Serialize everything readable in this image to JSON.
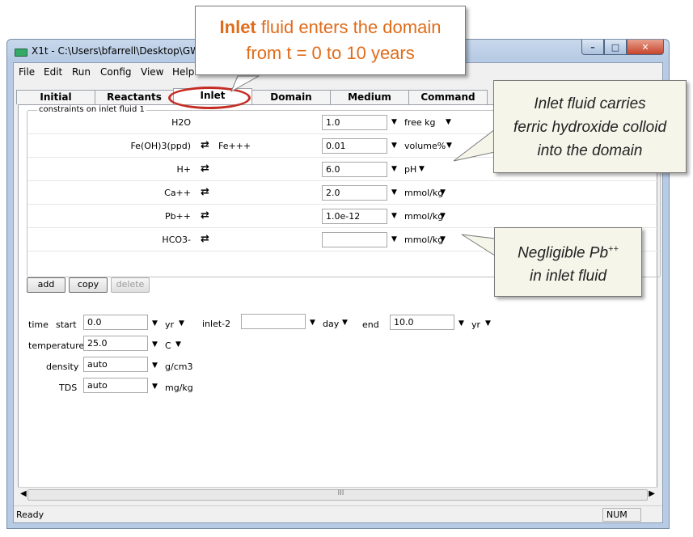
{
  "window": {
    "title": "X1t - C:\\Users\\bfarrell\\Desktop\\GWB10"
  },
  "title_controls": {
    "min": "–",
    "max": "□",
    "close": "✕"
  },
  "menu": [
    {
      "label": "File"
    },
    {
      "label": "Edit"
    },
    {
      "label": "Run"
    },
    {
      "label": "Config"
    },
    {
      "label": "View"
    },
    {
      "label": "Help"
    }
  ],
  "tabs": [
    {
      "label": "Initial"
    },
    {
      "label": "Reactants"
    },
    {
      "label": "Inlet"
    },
    {
      "label": "Domain"
    },
    {
      "label": "Medium"
    },
    {
      "label": "Command"
    }
  ],
  "constraints": {
    "legend": "constraints on inlet fluid 1",
    "swap_icon": "⇄",
    "rows": [
      {
        "species": "H2O",
        "swap": "",
        "basis": "",
        "value": "1.0",
        "unit": "free kg"
      },
      {
        "species": "Fe(OH)3(ppd)",
        "swap": "⇄",
        "basis": "Fe+++",
        "value": "0.01",
        "unit": "volume%"
      },
      {
        "species": "H+",
        "swap": "⇄",
        "basis": "",
        "value": "6.0",
        "unit": "pH"
      },
      {
        "species": "Ca++",
        "swap": "⇄",
        "basis": "",
        "value": "2.0",
        "unit": "mmol/kg"
      },
      {
        "species": "Pb++",
        "swap": "⇄",
        "basis": "",
        "value": "1.0e-12",
        "unit": "mmol/kg"
      },
      {
        "species": "HCO3-",
        "swap": "⇄",
        "basis": "",
        "value": "",
        "unit": "mmol/kg"
      }
    ]
  },
  "buttons": {
    "add": "add",
    "copy": "copy",
    "delete": "delete"
  },
  "time": {
    "label": "time",
    "start_label": "start",
    "start_value": "0.0",
    "start_unit": "yr",
    "inlet_label": "inlet-2",
    "inlet_value": "",
    "inlet_unit": "day",
    "end_label": "end",
    "end_value": "10.0",
    "end_unit": "yr"
  },
  "temperature": {
    "label": "temperature",
    "value": "25.0",
    "unit": "C"
  },
  "density": {
    "label": "density",
    "value": "auto",
    "unit": "g/cm3"
  },
  "tds": {
    "label": "TDS",
    "value": "auto",
    "unit": "mg/kg"
  },
  "scroll_thumb": "III",
  "status": {
    "text": "Ready",
    "num": "NUM"
  },
  "callouts": {
    "top_bold": "Inlet",
    "top_line1": " fluid enters the domain",
    "top_line2": "from t = 0 to 10 years",
    "side1_l1": "Inlet fluid carries",
    "side1_l2": "ferric hydroxide colloid",
    "side1_l3": "into the domain",
    "side2_l1": "Negligible Pb",
    "side2_sup": "++",
    "side2_l2": "in inlet fluid"
  },
  "colors": {
    "callout_text": "#e06c1a",
    "oval": "#c42d23"
  }
}
